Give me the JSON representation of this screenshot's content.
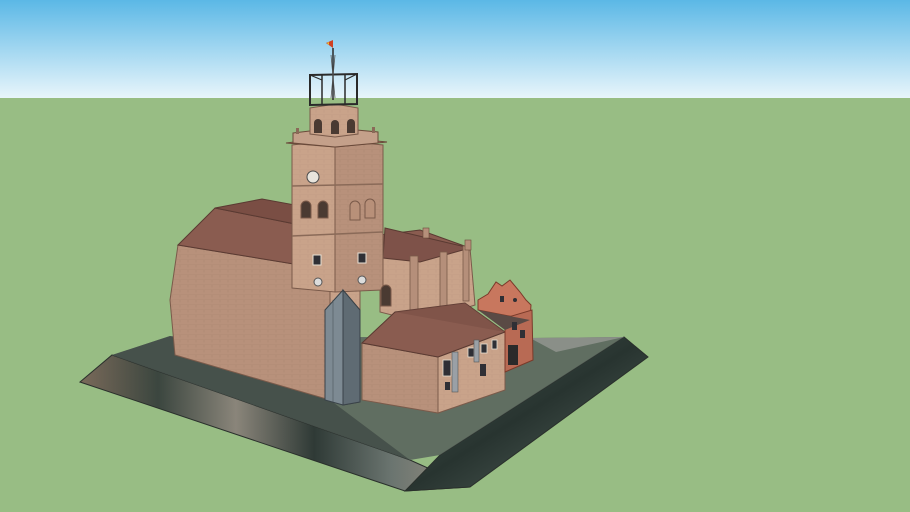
{
  "scene": {
    "subject": "church-3d-model",
    "colors": {
      "sky_top": "#5bb8e6",
      "sky_bottom": "#e6f4fb",
      "ground": "#98bd84",
      "wall": "#c9a38a",
      "wall_shadow": "#b38d77",
      "roof": "#8a5c50",
      "roof_dark": "#6f4840",
      "buttress": "#7d8a93",
      "annex": "#c8775e",
      "base_dark": "#3d4a45",
      "base_light": "#a59b8f"
    },
    "icons": [
      "flag-icon",
      "clock-icon"
    ]
  }
}
